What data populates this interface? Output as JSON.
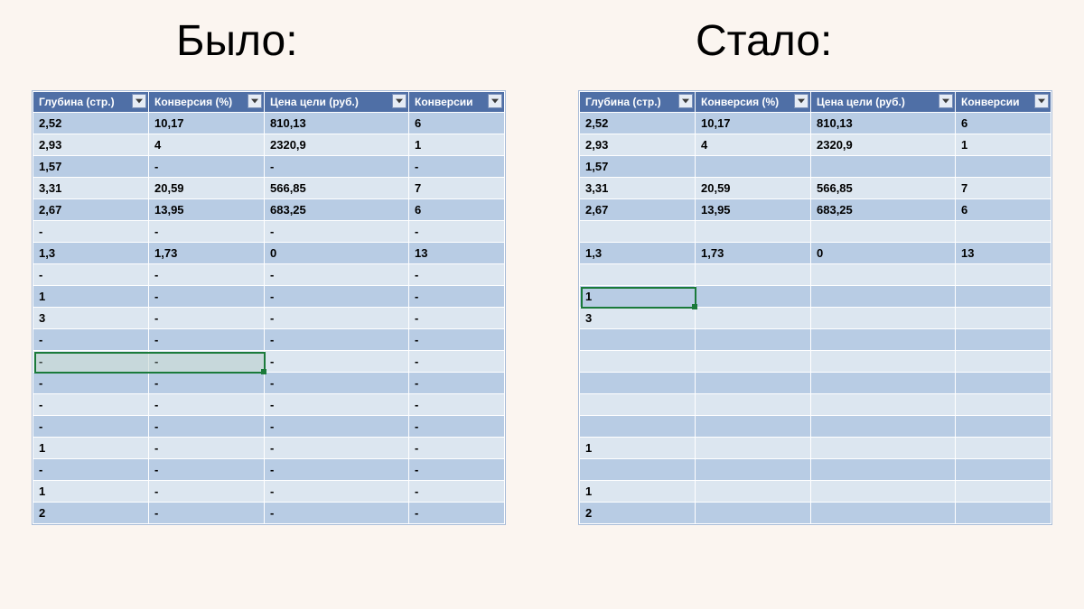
{
  "titles": {
    "left": "Было:",
    "right": "Стало:"
  },
  "headers": [
    "Глубина (стр.)",
    "Конверсия (%)",
    "Цена цели (руб.)",
    "Конверсии"
  ],
  "left_rows": [
    [
      "2,52",
      "10,17",
      "810,13",
      "6"
    ],
    [
      "2,93",
      "4",
      "2320,9",
      "1"
    ],
    [
      "1,57",
      "-",
      "-",
      "-"
    ],
    [
      "3,31",
      "20,59",
      "566,85",
      "7"
    ],
    [
      "2,67",
      "13,95",
      "683,25",
      "6"
    ],
    [
      "-",
      "-",
      "-",
      "-"
    ],
    [
      "1,3",
      "1,73",
      "0",
      "13"
    ],
    [
      "-",
      "-",
      "-",
      "-"
    ],
    [
      "1",
      "-",
      "-",
      "-"
    ],
    [
      "3",
      "-",
      "-",
      "-"
    ],
    [
      "-",
      "-",
      "-",
      "-"
    ],
    [
      "-",
      "-",
      "-",
      "-"
    ],
    [
      "-",
      "-",
      "-",
      "-"
    ],
    [
      "-",
      "-",
      "-",
      "-"
    ],
    [
      "-",
      "-",
      "-",
      "-"
    ],
    [
      "1",
      "-",
      "-",
      "-"
    ],
    [
      "-",
      "-",
      "-",
      "-"
    ],
    [
      "1",
      "-",
      "-",
      "-"
    ],
    [
      "2",
      "-",
      "-",
      "-"
    ]
  ],
  "right_rows": [
    [
      "2,52",
      "10,17",
      "810,13",
      "6"
    ],
    [
      "2,93",
      "4",
      "2320,9",
      "1"
    ],
    [
      "1,57",
      "",
      "",
      ""
    ],
    [
      "3,31",
      "20,59",
      "566,85",
      "7"
    ],
    [
      "2,67",
      "13,95",
      "683,25",
      "6"
    ],
    [
      "",
      "",
      "",
      ""
    ],
    [
      "1,3",
      "1,73",
      "0",
      "13"
    ],
    [
      "",
      "",
      "",
      ""
    ],
    [
      "1",
      "",
      "",
      ""
    ],
    [
      "3",
      "",
      "",
      ""
    ],
    [
      "",
      "",
      "",
      ""
    ],
    [
      "",
      "",
      "",
      ""
    ],
    [
      "",
      "",
      "",
      ""
    ],
    [
      "",
      "",
      "",
      ""
    ],
    [
      "",
      "",
      "",
      ""
    ],
    [
      "1",
      "",
      "",
      ""
    ],
    [
      "",
      "",
      "",
      ""
    ],
    [
      "1",
      "",
      "",
      ""
    ],
    [
      "2",
      "",
      "",
      ""
    ]
  ],
  "selection_left": {
    "row": 11,
    "col_start": 0,
    "col_span": 2
  },
  "selection_right": {
    "row": 8,
    "col": 0
  }
}
